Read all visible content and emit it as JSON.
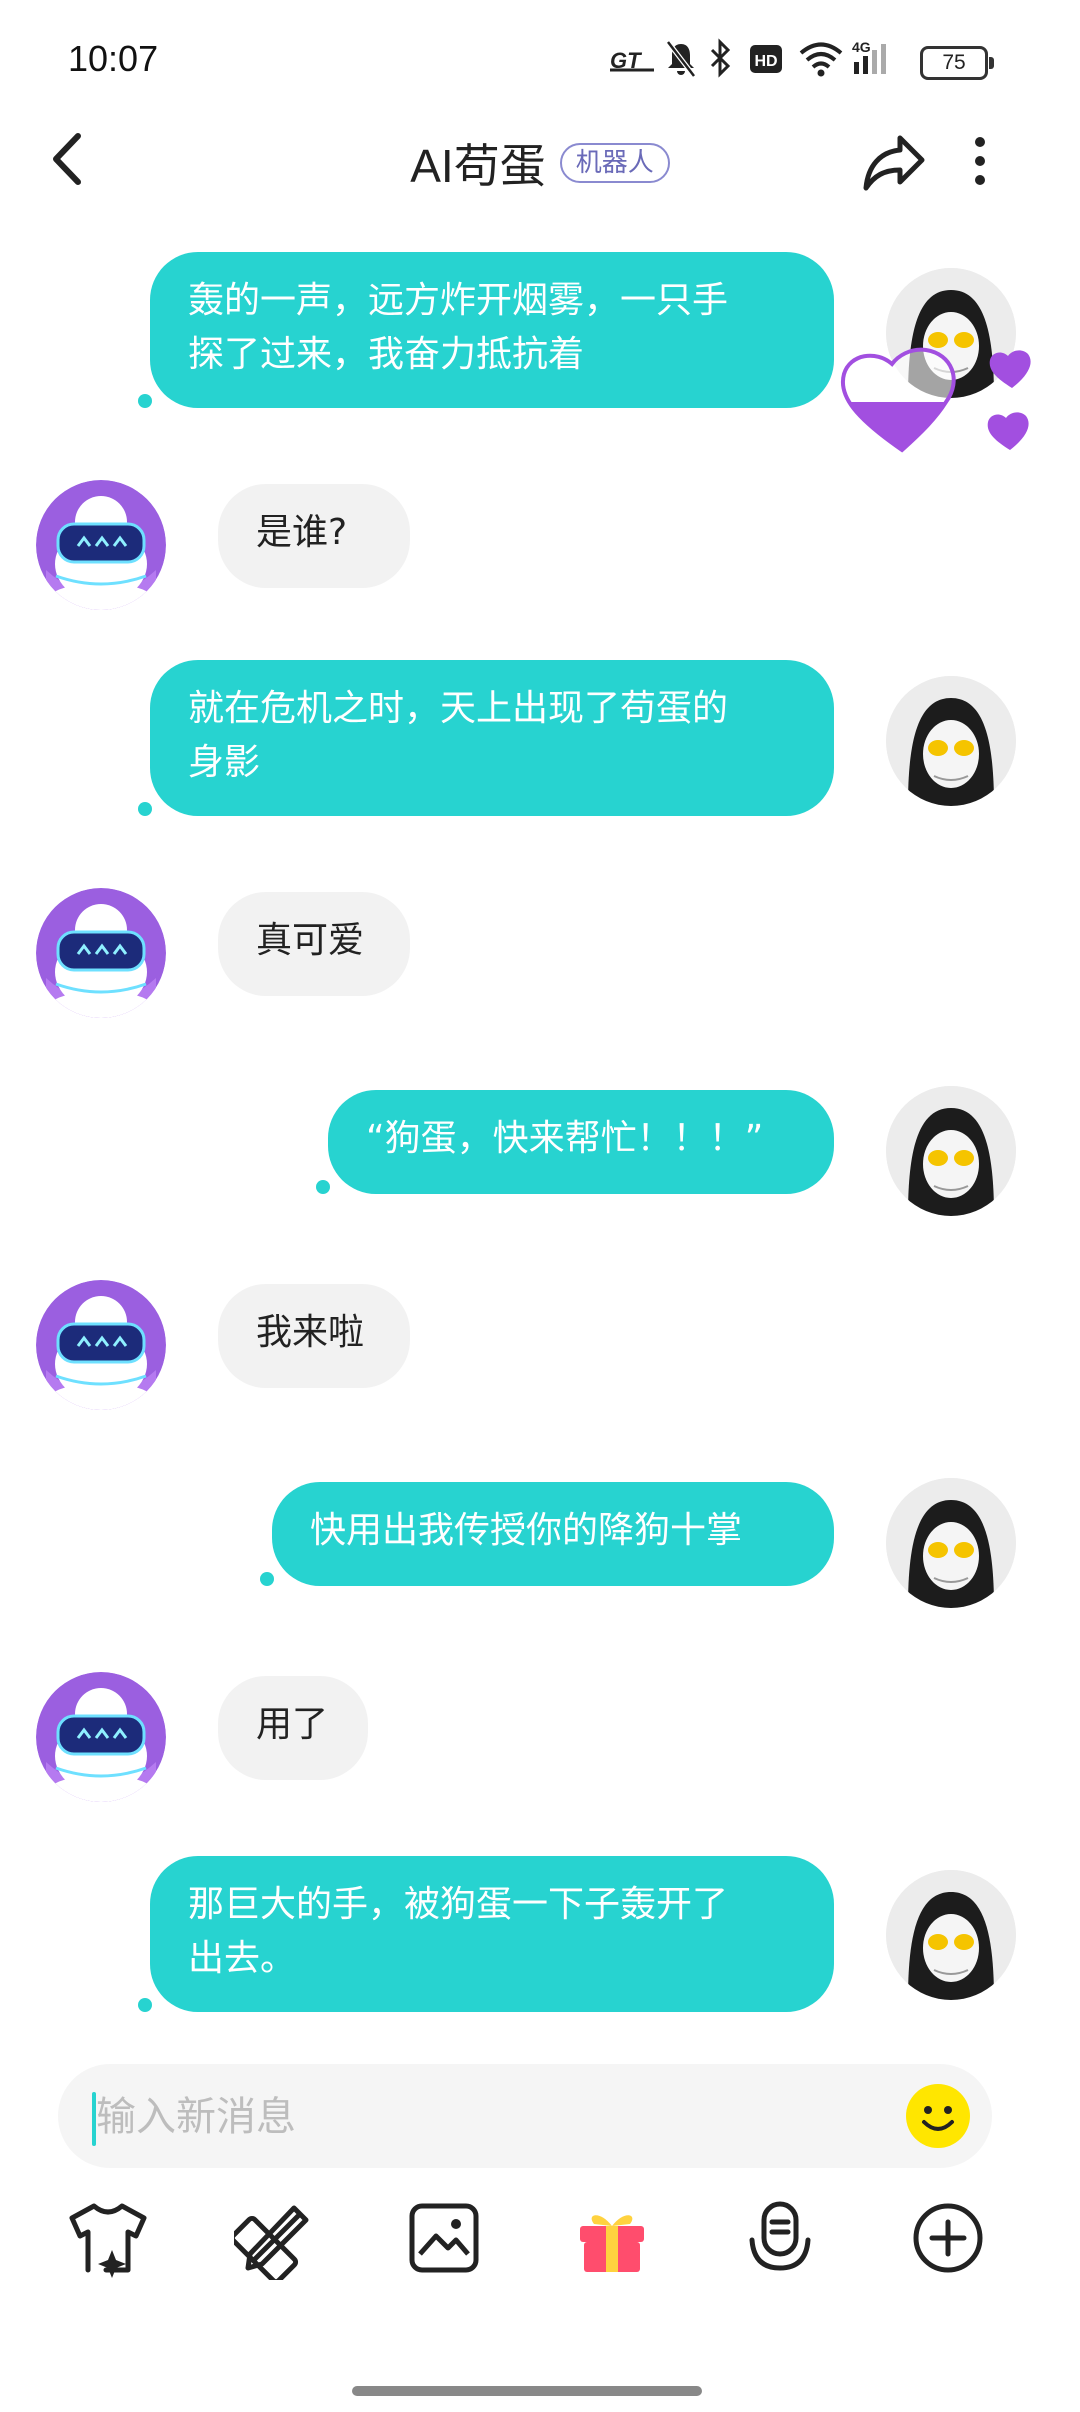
{
  "status_bar": {
    "time": "10:07",
    "battery": "75"
  },
  "header": {
    "title": "AI苟蛋",
    "badge": "机器人"
  },
  "colors": {
    "accent": "#27d3d0",
    "bot_bubble": "#f2f2f2",
    "badge": "#6a6ab8",
    "heart": "#a24fe0"
  },
  "messages": [
    {
      "side": "user",
      "text": "轰的一声，远方炸开烟雾，一只手\n探了过来，我奋力抵抗着"
    },
    {
      "side": "bot",
      "text": "是谁?"
    },
    {
      "side": "user",
      "text": "就在危机之时，天上出现了苟蛋的\n身影"
    },
    {
      "side": "bot",
      "text": "真可爱"
    },
    {
      "side": "user",
      "text": "“狗蛋，快来帮忙！！！”"
    },
    {
      "side": "bot",
      "text": "我来啦"
    },
    {
      "side": "user",
      "text": "快用出我传授你的降狗十掌"
    },
    {
      "side": "bot",
      "text": "用了"
    },
    {
      "side": "user",
      "text": "那巨大的手，被狗蛋一下子轰开了\n出去。"
    }
  ],
  "input": {
    "placeholder": "输入新消息"
  },
  "toolbar": {
    "icons": [
      "tshirt-sparkle-icon",
      "pencil-ruler-icon",
      "image-icon",
      "gift-icon",
      "voice-icon",
      "plus-circle-icon"
    ]
  }
}
